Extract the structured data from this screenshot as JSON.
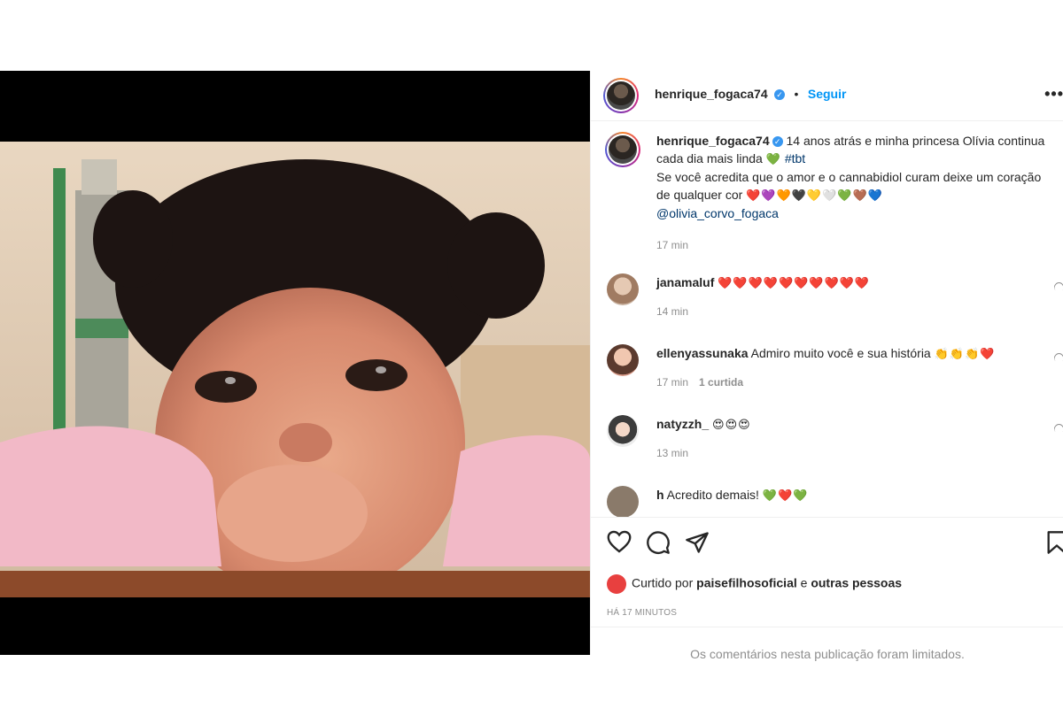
{
  "post": {
    "author": "henrique_fogaca74",
    "follow_label": "Seguir",
    "dot": "•",
    "more_label": "•••",
    "caption": {
      "username": "henrique_fogaca74",
      "line1": " 14 anos atrás e minha princesa Olívia continua cada dia mais linda ",
      "line1_emoji": "💚",
      "hashtag": "#tbt",
      "line2": "Se você acredita que o amor e o cannabidiol curam deixe um coração de qualquer cor ",
      "hearts": "❤️💜🧡🖤💛🤍💚🤎💙",
      "mention": "@olivia_corvo_fogaca",
      "time": "17 min"
    },
    "comments": [
      {
        "username": "janamaluf",
        "text": " ",
        "emoji": "❤️❤️❤️❤️❤️❤️❤️❤️❤️❤️",
        "time": "14 min",
        "likes": ""
      },
      {
        "username": "ellenyassunaka",
        "text": " Admiro muito você e sua história ",
        "emoji": "👏👏👏❤️",
        "time": "17 min",
        "likes": "1 curtida"
      },
      {
        "username": "natyzzh_",
        "text": " ",
        "emoji": "😍😍😍",
        "time": "13 min",
        "likes": ""
      }
    ],
    "partial_comment": {
      "username": "h",
      "text": " Acredito demais! ",
      "emoji": "💚❤️💚"
    },
    "liked_by": {
      "prefix": "Curtido por ",
      "user": "paisefilhosoficial",
      "middle": " e ",
      "others": "outras pessoas"
    },
    "date": "HÁ 17 MINUTOS",
    "limited_note": "Os comentários nesta publicação foram limitados."
  },
  "icons": {
    "like": "heart-icon",
    "comment": "comment-icon",
    "share": "share-icon",
    "save": "bookmark-icon",
    "verified": "verified-badge-icon",
    "options": "more-options-icon"
  },
  "colors": {
    "accent": "#0095f6",
    "verified": "#3897f0",
    "muted": "#8e8e8e",
    "text": "#262626",
    "media_bg": "#000000"
  }
}
